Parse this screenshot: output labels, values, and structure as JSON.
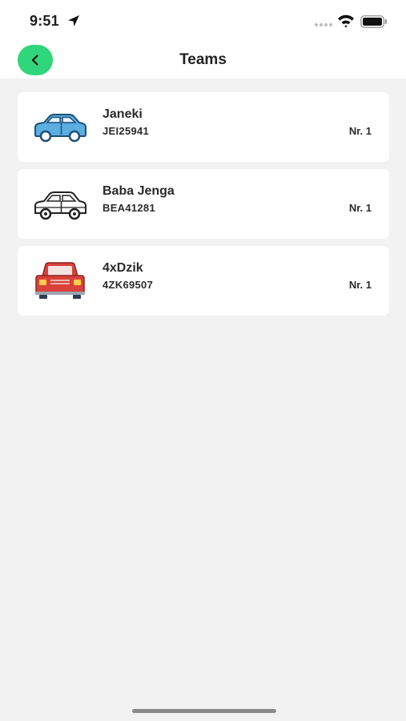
{
  "status_bar": {
    "time": "9:51",
    "icons": [
      "location-arrow-icon",
      "cellular-signal-icon",
      "wifi-icon",
      "battery-icon"
    ]
  },
  "nav": {
    "title": "Teams",
    "back_icon": "chevron-left-icon",
    "back_color": "#2fd67a"
  },
  "teams": [
    {
      "name": "Janeki",
      "code": "JEI25941",
      "rank": "Nr. 1",
      "icon": "blue-car-icon",
      "color": "#5aaee0"
    },
    {
      "name": "Baba Jenga",
      "code": "BEA41281",
      "rank": "Nr. 1",
      "icon": "outline-car-icon",
      "color": "#222222"
    },
    {
      "name": "4xDzik",
      "code": "4ZK69507",
      "rank": "Nr. 1",
      "icon": "red-jeep-icon",
      "color": "#d9413a"
    }
  ]
}
